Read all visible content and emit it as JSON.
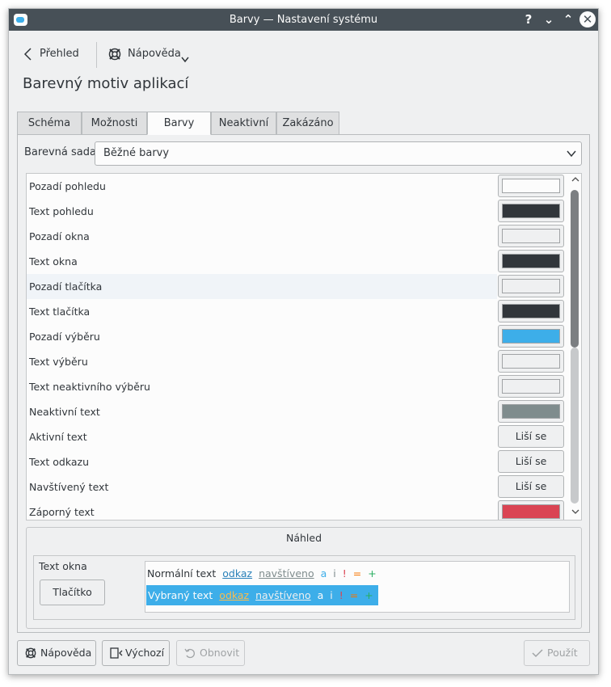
{
  "window": {
    "title": "Barvy  — Nastavení systému",
    "buttons": {
      "help": "?",
      "minimize": "⌄",
      "maximize": "⌃",
      "close": "✕"
    }
  },
  "nav": {
    "back_label": "Přehled",
    "help_label": "Nápověda"
  },
  "page_title": "Barevný motiv aplikací",
  "tabs": [
    {
      "label": "Schéma"
    },
    {
      "label": "Možnosti"
    },
    {
      "label": "Barvy",
      "active": true
    },
    {
      "label": "Neaktivní"
    },
    {
      "label": "Zakázáno"
    }
  ],
  "color_set": {
    "label": "Barevná sada:",
    "value": "Běžné barvy"
  },
  "color_rows": [
    {
      "label": "Pozadí pohledu",
      "color": "#fcfcfc"
    },
    {
      "label": "Text pohledu",
      "color": "#31363b"
    },
    {
      "label": "Pozadí okna",
      "color": "#eff0f1"
    },
    {
      "label": "Text okna",
      "color": "#31363b"
    },
    {
      "label": "Pozadí tlačítka",
      "color": "#eff0f1"
    },
    {
      "label": "Text tlačítka",
      "color": "#31363b"
    },
    {
      "label": "Pozadí výběru",
      "color": "#3daee9"
    },
    {
      "label": "Text výběru",
      "color": "#eff0f1"
    },
    {
      "label": "Text neaktivního výběru",
      "color": "#eff0f1"
    },
    {
      "label": "Neaktivní text",
      "color": "#7f8c8d"
    },
    {
      "label": "Aktivní text",
      "button_text": "Liší se"
    },
    {
      "label": "Text odkazu",
      "button_text": "Liší se"
    },
    {
      "label": "Navštívený text",
      "button_text": "Liší se"
    },
    {
      "label": "Záporný text",
      "color": "#da4453"
    }
  ],
  "preview": {
    "title": "Náhled",
    "window_text": "Text okna",
    "button": "Tlačítko",
    "normal": {
      "text": "Normální text",
      "link": "odkaz",
      "visited": "navštíveno",
      "a": "a",
      "i": "i",
      "excl": "!",
      "eq": "=",
      "plus": "+"
    },
    "selected": {
      "text": "Vybraný text",
      "link": "odkaz",
      "visited": "navštíveno",
      "a": "a",
      "i": "i",
      "excl": "!",
      "eq": "=",
      "plus": "+"
    }
  },
  "buttons": {
    "help": "Nápověda",
    "defaults": "Výchozí",
    "reset": "Obnovit",
    "apply": "Použít"
  },
  "colors": {
    "accent": "#3daee9",
    "titlebar": "#475057",
    "link_normal": "#2980b9",
    "visited_normal": "#7f8c8d",
    "link_selected": "#fdbc4b",
    "visited_selected": "#7f8c8d",
    "active_blue": "#3daee9",
    "neutral": "#f67400",
    "negative": "#da4453",
    "positive": "#27ae60"
  }
}
